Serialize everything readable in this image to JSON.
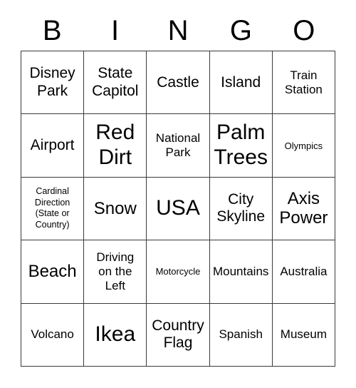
{
  "card": {
    "headers": [
      "B",
      "I",
      "N",
      "G",
      "O"
    ],
    "rows": [
      [
        {
          "text": "Disney\nPark",
          "size": "md"
        },
        {
          "text": "State\nCapitol",
          "size": "md"
        },
        {
          "text": "Castle",
          "size": "md"
        },
        {
          "text": "Island",
          "size": "md"
        },
        {
          "text": "Train\nStation",
          "size": "sm"
        }
      ],
      [
        {
          "text": "Airport",
          "size": "md"
        },
        {
          "text": "Red\nDirt",
          "size": "xl"
        },
        {
          "text": "National\nPark",
          "size": "sm"
        },
        {
          "text": "Palm\nTrees",
          "size": "xl"
        },
        {
          "text": "Olympics",
          "size": "xs"
        }
      ],
      [
        {
          "text": "Cardinal\nDirection\n(State or\nCountry)",
          "size": "xxs"
        },
        {
          "text": "Snow",
          "size": "lg"
        },
        {
          "text": "USA",
          "size": "xl"
        },
        {
          "text": "City\nSkyline",
          "size": "md"
        },
        {
          "text": "Axis\nPower",
          "size": "lg"
        }
      ],
      [
        {
          "text": "Beach",
          "size": "lg"
        },
        {
          "text": "Driving\non the\nLeft",
          "size": "sm"
        },
        {
          "text": "Motorcycle",
          "size": "xs"
        },
        {
          "text": "Mountains",
          "size": "sm"
        },
        {
          "text": "Australia",
          "size": "sm"
        }
      ],
      [
        {
          "text": "Volcano",
          "size": "sm"
        },
        {
          "text": "Ikea",
          "size": "xl"
        },
        {
          "text": "Country\nFlag",
          "size": "md"
        },
        {
          "text": "Spanish",
          "size": "sm"
        },
        {
          "text": "Museum",
          "size": "sm"
        }
      ]
    ]
  }
}
